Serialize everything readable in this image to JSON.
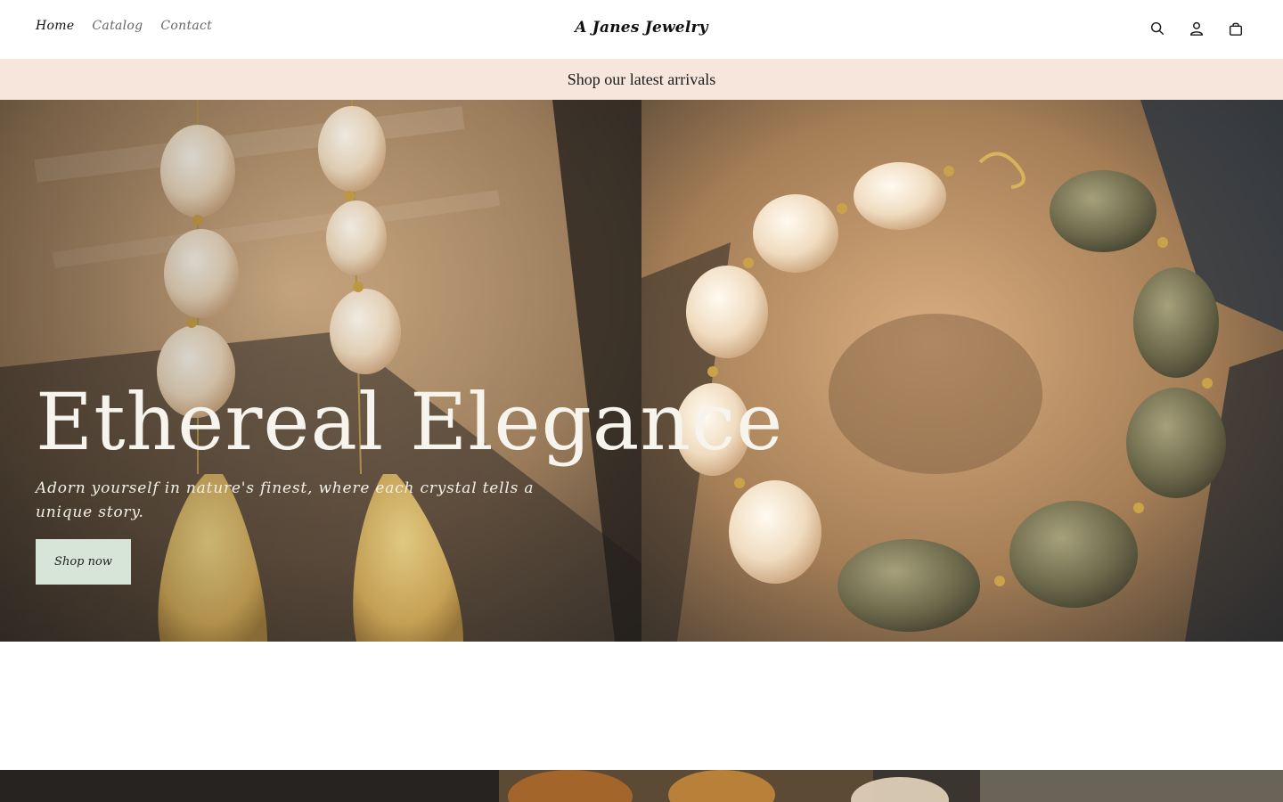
{
  "header": {
    "nav": [
      {
        "label": "Home"
      },
      {
        "label": "Catalog"
      },
      {
        "label": "Contact"
      }
    ],
    "logo": "A Janes Jewelry",
    "icons": [
      "search-icon",
      "account-icon",
      "cart-icon"
    ]
  },
  "announcement": {
    "text": "Shop our latest arrivals"
  },
  "hero": {
    "title": "Ethereal Elegance",
    "subtitle": "Adorn yourself in nature's finest, where each crystal tells a unique story.",
    "cta_label": "Shop now"
  },
  "colors": {
    "announcement_bg": "#f7e6dc",
    "button_bg": "#d6e5d8",
    "hero_text": "#f6f4ec"
  }
}
